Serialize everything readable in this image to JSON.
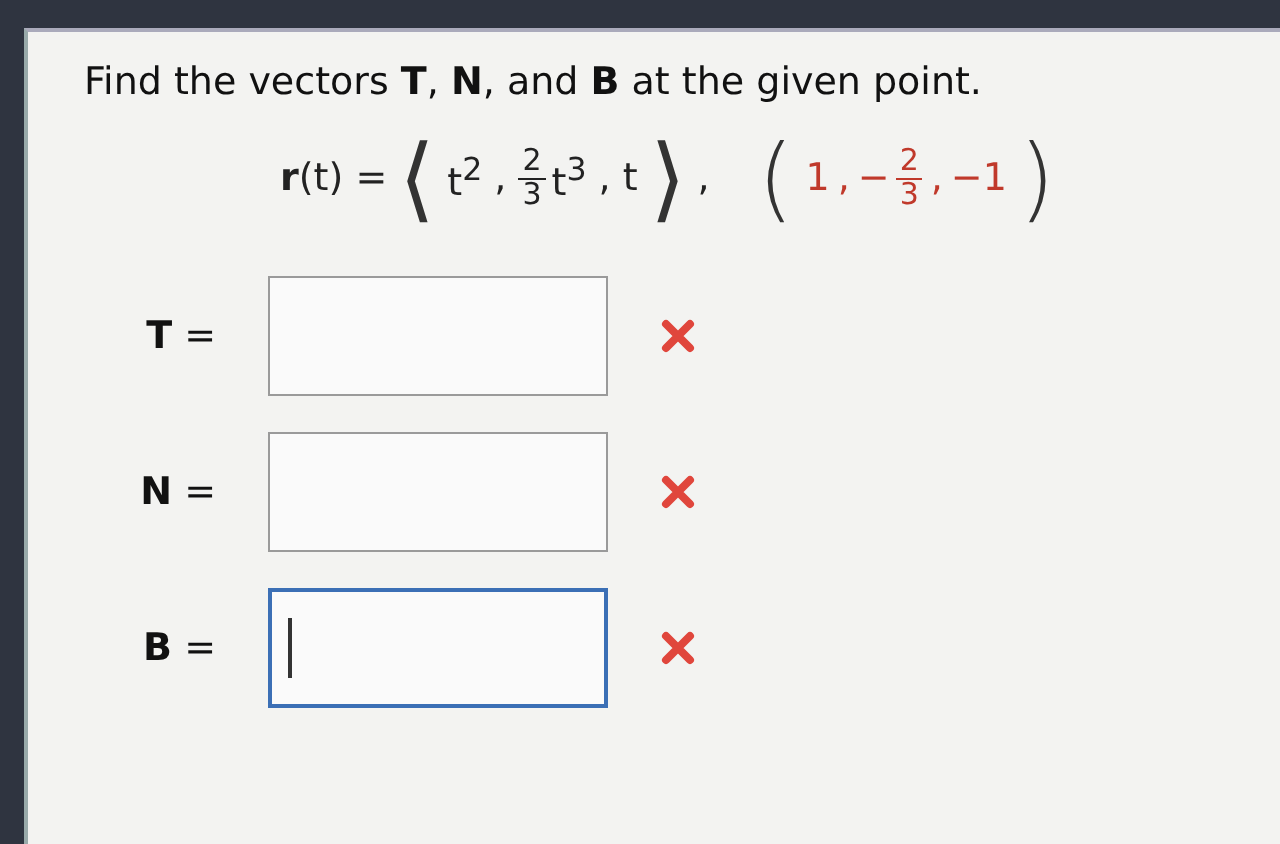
{
  "question": {
    "prompt": "Find the vectors **T**, **N**, and **B** at the given point.",
    "function": {
      "lhs": "**r**(t) =",
      "open": "⟨",
      "close": "⟩",
      "separator": ",",
      "trail": ",",
      "components": [
        {
          "kind": "text",
          "text": "t$^{2}$"
        },
        {
          "kind": "frac",
          "num": "2",
          "den": "3",
          "text": "t$^{3}$"
        },
        {
          "kind": "text",
          "text": "t"
        }
      ]
    },
    "point": {
      "open": "(",
      "close": ")",
      "separator": ",",
      "components": [
        {
          "kind": "text",
          "text": "1"
        },
        {
          "kind": "frac",
          "sign": "−",
          "num": "2",
          "den": "3"
        },
        {
          "kind": "text",
          "text": "−1"
        }
      ]
    }
  },
  "answers": [
    {
      "label": "**T** =",
      "focused": false,
      "correct": false
    },
    {
      "label": "**N** =",
      "focused": false,
      "correct": false
    },
    {
      "label": "**B** =",
      "focused": true,
      "correct": false
    }
  ]
}
